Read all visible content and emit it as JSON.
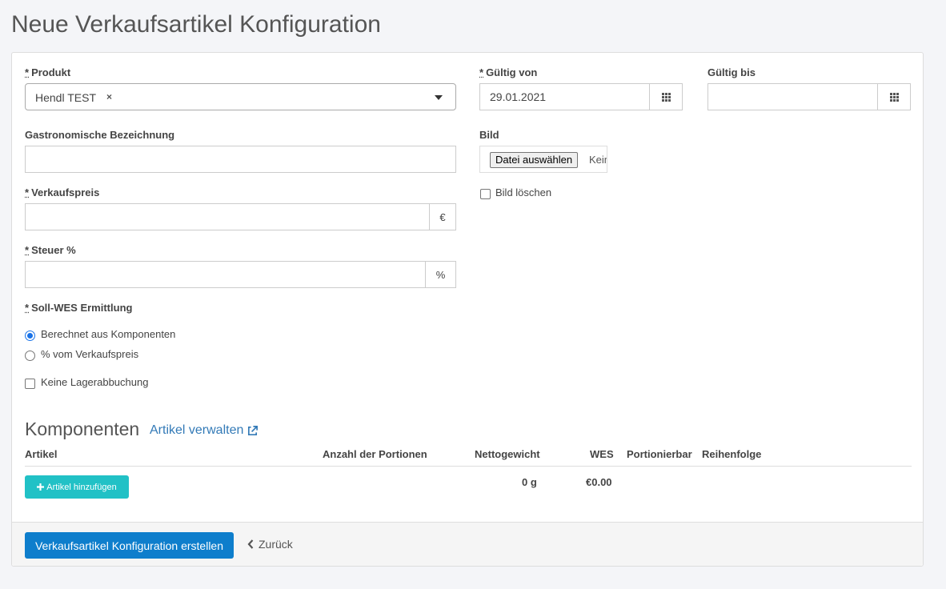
{
  "page": {
    "title": "Neue Verkaufsartikel Konfiguration"
  },
  "form": {
    "required_marker": "*",
    "produkt": {
      "label": "Produkt",
      "value": "Hendl TEST",
      "clear": "×"
    },
    "gueltig_von": {
      "label": "Gültig von",
      "value": "29.01.2021"
    },
    "gueltig_bis": {
      "label": "Gültig bis",
      "value": ""
    },
    "gastro": {
      "label": "Gastronomische Bezeichnung",
      "value": ""
    },
    "bild": {
      "label": "Bild",
      "button": "Datei auswählen",
      "status": "Keine ausgewählt",
      "delete_label": "Bild löschen"
    },
    "verkaufspreis": {
      "label": "Verkaufspreis",
      "value": "",
      "addon": "€"
    },
    "steuer": {
      "label": "Steuer %",
      "value": "",
      "addon": "%"
    },
    "soll_wes": {
      "label": "Soll-WES Ermittlung",
      "options": [
        {
          "label": "Berechnet aus Komponenten",
          "selected": true
        },
        {
          "label": "% vom Verkaufspreis",
          "selected": false
        }
      ]
    },
    "keine_lager": {
      "label": "Keine Lagerabbuchung",
      "checked": false
    }
  },
  "komponenten": {
    "title": "Komponenten",
    "manage_link": "Artikel verwalten",
    "columns": [
      "Artikel",
      "Anzahl der Portionen",
      "Nettogewicht",
      "WES",
      "Portionierbar",
      "Reihenfolge"
    ],
    "add_button": "Artikel hinzufügen",
    "totals": {
      "nettogewicht": "0 g",
      "wes": "€0.00"
    }
  },
  "footer": {
    "submit": "Verkaufsartikel Konfiguration erstellen",
    "back": "Zurück"
  },
  "colors": {
    "primary": "#0e7ecc",
    "accent": "#21c1c6",
    "link": "#337ab7"
  }
}
